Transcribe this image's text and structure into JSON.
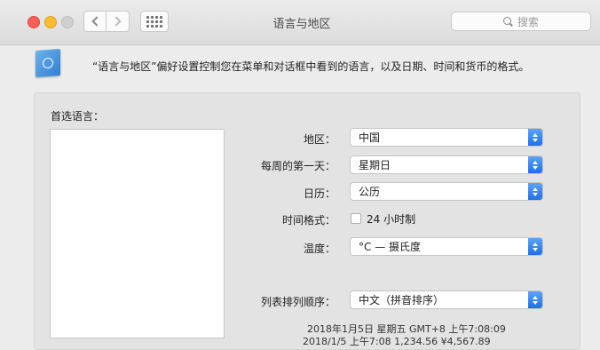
{
  "window": {
    "title": "语言与地区",
    "search_placeholder": "搜索"
  },
  "header": {
    "description": "“语言与地区”偏好设置控制您在菜单和对话框中看到的语言，以及日期、时间和货币的格式。"
  },
  "preferred_languages": {
    "label": "首选语言："
  },
  "settings": {
    "region": {
      "label": "地区：",
      "value": "中国"
    },
    "first_day": {
      "label": "每周的第一天：",
      "value": "星期日"
    },
    "calendar": {
      "label": "日历：",
      "value": "公历"
    },
    "time_format": {
      "label": "时间格式：",
      "checkbox_label": "24 小时制",
      "checked": false
    },
    "temperature": {
      "label": "温度：",
      "value": "°C — 摄氏度"
    },
    "list_sort": {
      "label": "列表排列顺序：",
      "value": "中文（拼音排序）"
    }
  },
  "samples": {
    "line1": "2018年1月5日 星期五 GMT+8 上午7:08:09",
    "line2": "2018/1/5 上午7:08    1,234.56    ¥4,567.89"
  },
  "colors": {
    "accent": "#1f6fe6",
    "close": "#fc5f57",
    "minimize": "#fdbc2e"
  }
}
